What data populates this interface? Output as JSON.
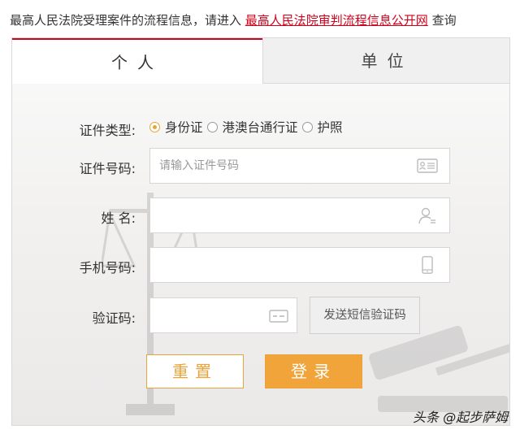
{
  "notice": {
    "prefix": "最高人民法院受理案件的流程信息，请进入",
    "link": "最高人民法院审判流程信息公开网",
    "suffix": "查询"
  },
  "tabs": [
    {
      "label": "个人",
      "active": true
    },
    {
      "label": "单位",
      "active": false
    }
  ],
  "form": {
    "id_type": {
      "label": "证件类型:",
      "options": [
        {
          "label": "身份证",
          "selected": true
        },
        {
          "label": "港澳台通行证",
          "selected": false
        },
        {
          "label": "护照",
          "selected": false
        }
      ]
    },
    "id_number": {
      "label": "证件号码:",
      "placeholder": "请输入证件号码",
      "icon": "id-card-icon"
    },
    "name": {
      "label": "姓 名:",
      "placeholder": "",
      "icon": "user-icon"
    },
    "phone": {
      "label": "手机号码:",
      "placeholder": "",
      "icon": "phone-icon"
    },
    "captcha": {
      "label": "验证码:",
      "placeholder": "",
      "icon": "captcha-icon",
      "sms_button": "发送短信验证码"
    }
  },
  "buttons": {
    "reset": "重置",
    "login": "登录"
  },
  "watermark": "头条 @起步萨姆",
  "colors": {
    "accent": "#f0a43a",
    "link": "#d0021b",
    "tab_border": "#d0021b"
  }
}
